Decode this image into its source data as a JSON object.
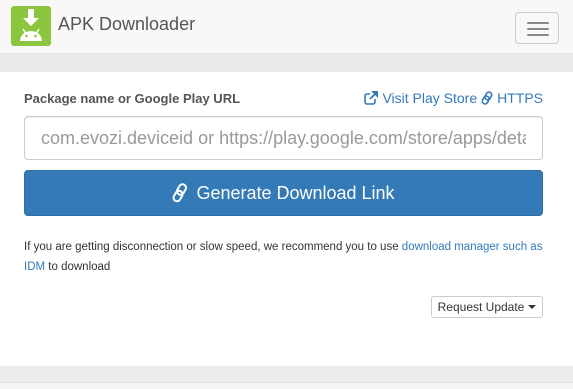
{
  "navbar": {
    "title": "APK Downloader",
    "logo_icon": "android-download-icon",
    "menu_icon": "hamburger-menu-icon"
  },
  "form": {
    "label": "Package name or Google Play URL",
    "visit_store_label": "Visit Play Store",
    "https_label": "HTTPS",
    "input_placeholder": "com.evozi.deviceid or https://play.google.com/store/apps/details?id=com.evozi.deviceid",
    "input_value": "",
    "generate_label": "Generate Download Link"
  },
  "note": {
    "text_before": "If you are getting disconnection or slow speed, we recommend you to use ",
    "link": "download manager such as IDM",
    "text_after": " to download"
  },
  "request_update": {
    "label": "Request Update"
  },
  "colors": {
    "primary": "#337ab7",
    "logo_green": "#8cc63e",
    "navbar_bg": "#f8f8f8"
  }
}
